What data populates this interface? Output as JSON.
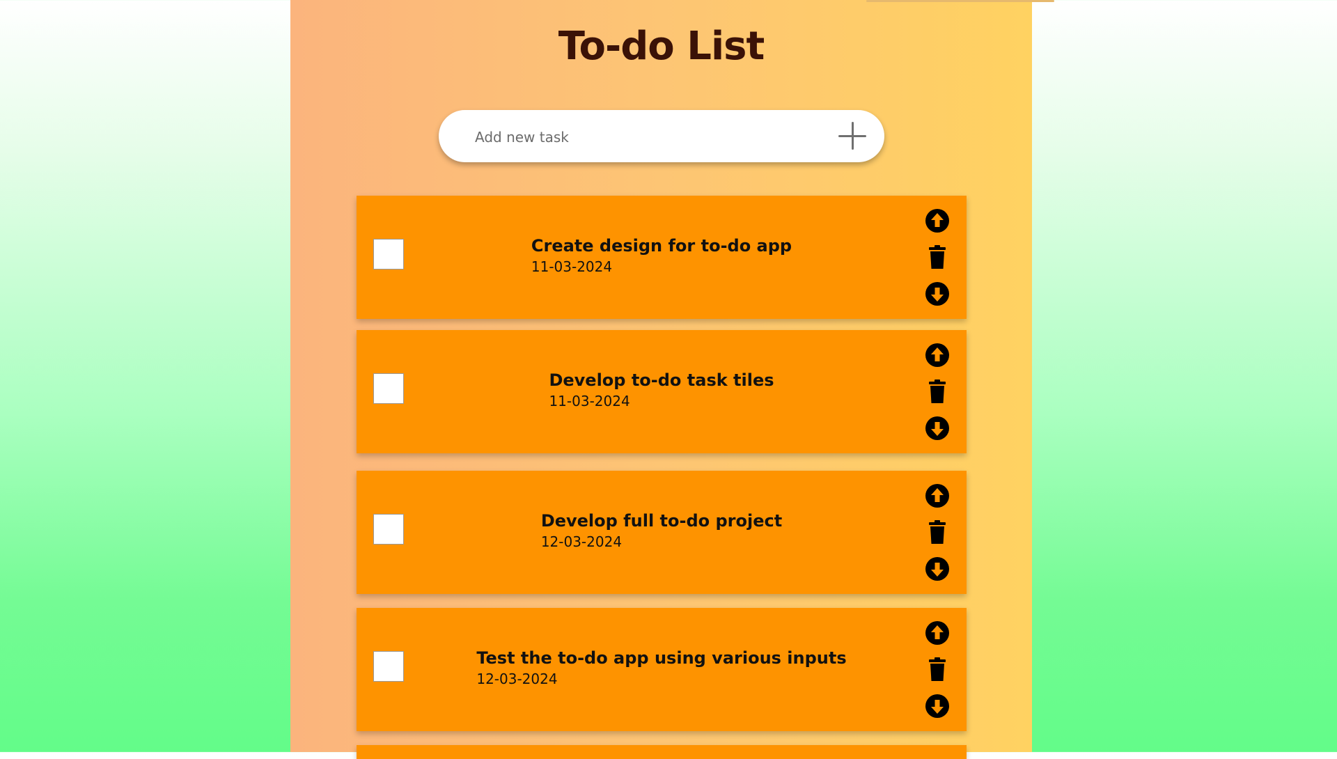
{
  "app": {
    "title": "To-do List"
  },
  "add_task": {
    "placeholder": "Add new task",
    "add_icon": "plus-icon"
  },
  "tasks": [
    {
      "title": "Create design for to-do app",
      "date": "11-03-2024",
      "done": false
    },
    {
      "title": "Develop to-do task tiles",
      "date": "11-03-2024",
      "done": false
    },
    {
      "title": "Develop full to-do project",
      "date": "12-03-2024",
      "done": false
    },
    {
      "title": "Test the to-do app using various inputs",
      "date": "12-03-2024",
      "done": false
    }
  ],
  "task_icons": [
    "arrow-up-circle-icon",
    "trash-icon",
    "arrow-down-circle-icon"
  ],
  "colors": {
    "task_tile": "#fe9300",
    "title_text": "#3b1207",
    "panel_left": "#fbb47d",
    "panel_right": "#ffd261",
    "background_bottom": "#63fc89"
  }
}
